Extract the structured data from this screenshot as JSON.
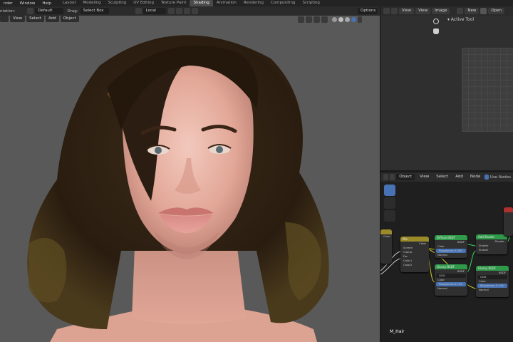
{
  "topbar": {
    "menus": [
      "nder",
      "Window",
      "Help"
    ],
    "workspaces": [
      "Layout",
      "Modeling",
      "Sculpting",
      "UV Editing",
      "Texture Paint",
      "Shading",
      "Animation",
      "Rendering",
      "Compositing",
      "Scripting"
    ],
    "active_workspace": "Shading"
  },
  "viewport_header": {
    "orientation_label": "ntation:",
    "orientation_value": "Default",
    "drag_label": "Drag:",
    "drag_value": "Select Box",
    "transform_value": "Local",
    "options_label": "Options"
  },
  "viewport_menus": [
    "View",
    "Select",
    "Add",
    "Object"
  ],
  "image_editor": {
    "menus": [
      "View",
      "View",
      "Image"
    ],
    "new_label": "New",
    "open_label": "Open",
    "active_tool_label": "Active Tool"
  },
  "node_editor": {
    "object_label": "Object",
    "menus": [
      "View",
      "Select",
      "Add",
      "Node"
    ],
    "use_nodes_label": "Use Nodes",
    "material_name": "M_Hair",
    "nodes": {
      "mix_title": "Mix",
      "mix_rows": [
        "Color",
        "Screen",
        "Clamp",
        "Fac",
        "Color1",
        "Color2"
      ],
      "diffuse_title": "Diffuse BSDF",
      "diffuse_rows": [
        "BSDF",
        "Color",
        "Roughness 0.000",
        "Normal"
      ],
      "glossy1_title": "Glossy BSDF",
      "glossy1_rows": [
        "BSDF",
        "GGX",
        "Color",
        "Roughness 0.100",
        "Normal"
      ],
      "add_title": "Add Shader",
      "add_rows": [
        "Shader",
        "Shader",
        "Shader"
      ],
      "glossy2_title": "Glossy BSDF",
      "glossy2_rows": [
        "BSDF",
        "GGX",
        "Color",
        "Roughness 0.144",
        "Normal"
      ]
    }
  },
  "colors": {
    "viewport_bg": "#595959",
    "node_shader_header": "#2f9a4a",
    "node_color_header": "#9a8a2a",
    "active_tab": "#4a4a4a",
    "accent_blue": "#4772b3"
  }
}
